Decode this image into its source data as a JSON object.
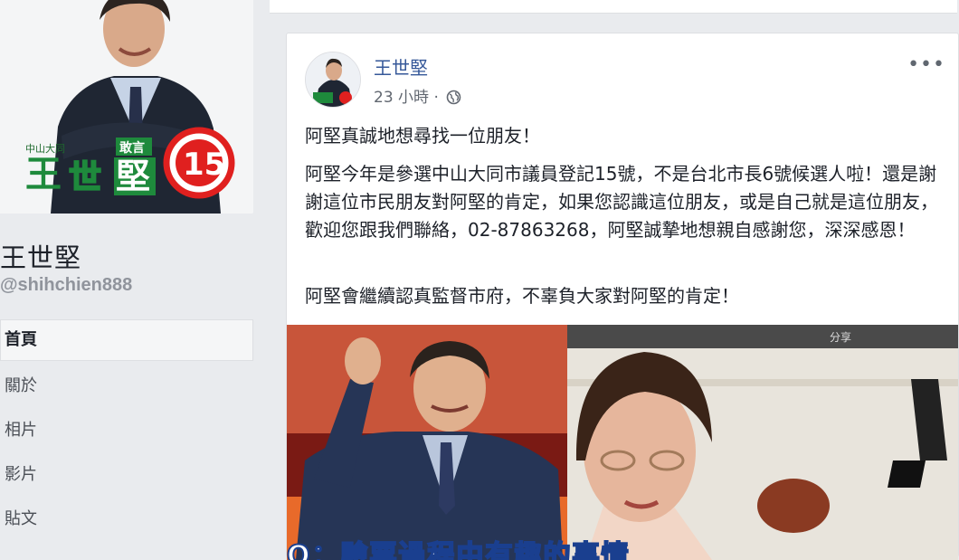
{
  "profile": {
    "name": "王世堅",
    "handle": "@shihchien888",
    "photo_label": "王世堅",
    "poster_tag": "中山大同",
    "poster_text": "敢言",
    "number": "15"
  },
  "nav": {
    "items": [
      "首頁",
      "關於",
      "相片",
      "影片",
      "貼文"
    ]
  },
  "post": {
    "author": "王世堅",
    "time": "23 小時 · ",
    "more": "•••",
    "paragraphs": [
      "阿堅真誠地想尋找一位朋友！",
      "阿堅今年是參選中山大同市議員登記15號，不是台北市長6號候選人啦！還是謝謝這位市民朋友對阿堅的肯定，如果您認識這位朋友，或是自己就是這位朋友，歡迎您跟我們聯絡，02-87863268，阿堅誠摯地想親自感謝您，深深感恩！",
      "阿堅會繼續認真監督市府，不辜負大家對阿堅的肯定！"
    ],
    "video_caption": "Q：驗票過程中有趣的事情",
    "video_corner": "分享"
  },
  "colors": {
    "link": "#365899",
    "badge_red": "#e0201f",
    "poster_green": "#1e8a3c"
  }
}
